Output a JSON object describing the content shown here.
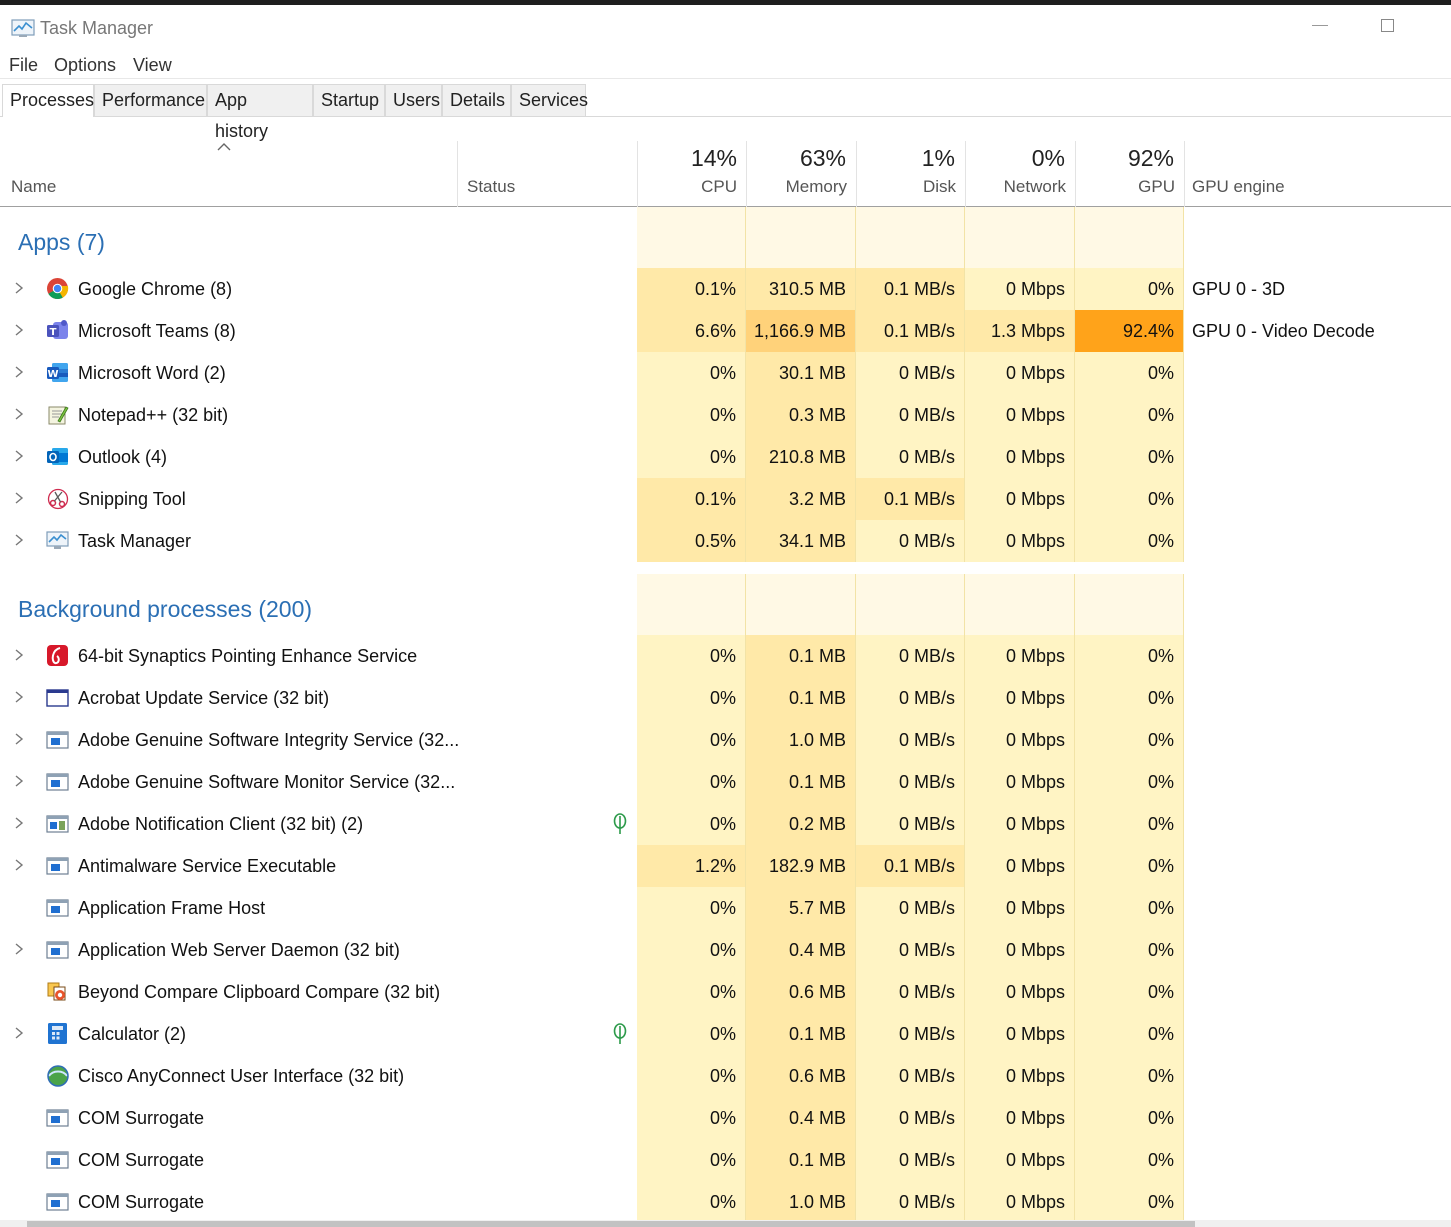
{
  "window": {
    "title": "Task Manager"
  },
  "menu": [
    "File",
    "Options",
    "View"
  ],
  "tabs": [
    "Processes",
    "Performance",
    "App history",
    "Startup",
    "Users",
    "Details",
    "Services"
  ],
  "active_tab": "Processes",
  "columns": {
    "name": "Name",
    "status": "Status",
    "cpu": {
      "label": "CPU",
      "pct": "14%"
    },
    "memory": {
      "label": "Memory",
      "pct": "63%"
    },
    "disk": {
      "label": "Disk",
      "pct": "1%"
    },
    "network": {
      "label": "Network",
      "pct": "0%"
    },
    "gpu": {
      "label": "GPU",
      "pct": "92%"
    },
    "gpu_engine": "GPU engine"
  },
  "heat_colors": {
    "light": "#fff4c4",
    "medium": "#ffe9a8",
    "strong": "#ffd27a",
    "hot": "#ffa31a",
    "group": "#fff9e5"
  },
  "groups": [
    {
      "title": "Apps (7)",
      "rows": [
        {
          "icon": "chrome-icon",
          "name": "Google Chrome (8)",
          "expand": true,
          "status_icon": "",
          "cpu": "0.1%",
          "memory": "310.5 MB",
          "disk": "0.1 MB/s",
          "network": "0 Mbps",
          "gpu": "0%",
          "gpu_engine": "GPU 0 - 3D",
          "heat": {
            "cpu": "medium",
            "memory": "medium",
            "disk": "medium",
            "network": "light",
            "gpu": "light"
          }
        },
        {
          "icon": "teams-icon",
          "name": "Microsoft Teams (8)",
          "expand": true,
          "status_icon": "",
          "cpu": "6.6%",
          "memory": "1,166.9 MB",
          "disk": "0.1 MB/s",
          "network": "1.3 Mbps",
          "gpu": "92.4%",
          "gpu_engine": "GPU 0 - Video Decode",
          "heat": {
            "cpu": "medium",
            "memory": "strong",
            "disk": "medium",
            "network": "medium",
            "gpu": "hot"
          }
        },
        {
          "icon": "word-icon",
          "name": "Microsoft Word (2)",
          "expand": true,
          "status_icon": "",
          "cpu": "0%",
          "memory": "30.1 MB",
          "disk": "0 MB/s",
          "network": "0 Mbps",
          "gpu": "0%",
          "gpu_engine": "",
          "heat": {
            "cpu": "light",
            "memory": "medium",
            "disk": "light",
            "network": "light",
            "gpu": "light"
          }
        },
        {
          "icon": "notepadpp-icon",
          "name": "Notepad++ (32 bit)",
          "expand": true,
          "status_icon": "",
          "cpu": "0%",
          "memory": "0.3 MB",
          "disk": "0 MB/s",
          "network": "0 Mbps",
          "gpu": "0%",
          "gpu_engine": "",
          "heat": {
            "cpu": "light",
            "memory": "medium",
            "disk": "light",
            "network": "light",
            "gpu": "light"
          }
        },
        {
          "icon": "outlook-icon",
          "name": "Outlook (4)",
          "expand": true,
          "status_icon": "",
          "cpu": "0%",
          "memory": "210.8 MB",
          "disk": "0 MB/s",
          "network": "0 Mbps",
          "gpu": "0%",
          "gpu_engine": "",
          "heat": {
            "cpu": "light",
            "memory": "medium",
            "disk": "light",
            "network": "light",
            "gpu": "light"
          }
        },
        {
          "icon": "snipping-tool-icon",
          "name": "Snipping Tool",
          "expand": true,
          "status_icon": "",
          "cpu": "0.1%",
          "memory": "3.2 MB",
          "disk": "0.1 MB/s",
          "network": "0 Mbps",
          "gpu": "0%",
          "gpu_engine": "",
          "heat": {
            "cpu": "medium",
            "memory": "medium",
            "disk": "medium",
            "network": "light",
            "gpu": "light"
          }
        },
        {
          "icon": "task-manager-icon",
          "name": "Task Manager",
          "expand": true,
          "status_icon": "",
          "cpu": "0.5%",
          "memory": "34.1 MB",
          "disk": "0 MB/s",
          "network": "0 Mbps",
          "gpu": "0%",
          "gpu_engine": "",
          "heat": {
            "cpu": "medium",
            "memory": "medium",
            "disk": "light",
            "network": "light",
            "gpu": "light"
          }
        }
      ]
    },
    {
      "title": "Background processes (200)",
      "rows": [
        {
          "icon": "synaptics-icon",
          "name": "64-bit Synaptics Pointing Enhance Service",
          "expand": true,
          "status_icon": "",
          "cpu": "0%",
          "memory": "0.1 MB",
          "disk": "0 MB/s",
          "network": "0 Mbps",
          "gpu": "0%",
          "gpu_engine": "",
          "heat": {
            "cpu": "light",
            "memory": "medium",
            "disk": "light",
            "network": "light",
            "gpu": "light"
          }
        },
        {
          "icon": "window-icon",
          "name": "Acrobat Update Service (32 bit)",
          "expand": true,
          "status_icon": "",
          "cpu": "0%",
          "memory": "0.1 MB",
          "disk": "0 MB/s",
          "network": "0 Mbps",
          "gpu": "0%",
          "gpu_engine": "",
          "heat": {
            "cpu": "light",
            "memory": "medium",
            "disk": "light",
            "network": "light",
            "gpu": "light"
          }
        },
        {
          "icon": "service-icon",
          "name": "Adobe Genuine Software Integrity Service (32...",
          "expand": true,
          "status_icon": "",
          "cpu": "0%",
          "memory": "1.0 MB",
          "disk": "0 MB/s",
          "network": "0 Mbps",
          "gpu": "0%",
          "gpu_engine": "",
          "heat": {
            "cpu": "light",
            "memory": "medium",
            "disk": "light",
            "network": "light",
            "gpu": "light"
          }
        },
        {
          "icon": "service-icon",
          "name": "Adobe Genuine Software Monitor Service (32...",
          "expand": true,
          "status_icon": "",
          "cpu": "0%",
          "memory": "0.1 MB",
          "disk": "0 MB/s",
          "network": "0 Mbps",
          "gpu": "0%",
          "gpu_engine": "",
          "heat": {
            "cpu": "light",
            "memory": "medium",
            "disk": "light",
            "network": "light",
            "gpu": "light"
          }
        },
        {
          "icon": "notification-client-icon",
          "name": "Adobe Notification Client (32 bit) (2)",
          "expand": true,
          "status_icon": "leaf-icon",
          "cpu": "0%",
          "memory": "0.2 MB",
          "disk": "0 MB/s",
          "network": "0 Mbps",
          "gpu": "0%",
          "gpu_engine": "",
          "heat": {
            "cpu": "light",
            "memory": "medium",
            "disk": "light",
            "network": "light",
            "gpu": "light"
          }
        },
        {
          "icon": "service-icon",
          "name": "Antimalware Service Executable",
          "expand": true,
          "status_icon": "",
          "cpu": "1.2%",
          "memory": "182.9 MB",
          "disk": "0.1 MB/s",
          "network": "0 Mbps",
          "gpu": "0%",
          "gpu_engine": "",
          "heat": {
            "cpu": "medium",
            "memory": "medium",
            "disk": "medium",
            "network": "light",
            "gpu": "light"
          }
        },
        {
          "icon": "service-icon",
          "name": "Application Frame Host",
          "expand": false,
          "status_icon": "",
          "cpu": "0%",
          "memory": "5.7 MB",
          "disk": "0 MB/s",
          "network": "0 Mbps",
          "gpu": "0%",
          "gpu_engine": "",
          "heat": {
            "cpu": "light",
            "memory": "medium",
            "disk": "light",
            "network": "light",
            "gpu": "light"
          }
        },
        {
          "icon": "service-icon",
          "name": "Application Web Server Daemon (32 bit)",
          "expand": true,
          "status_icon": "",
          "cpu": "0%",
          "memory": "0.4 MB",
          "disk": "0 MB/s",
          "network": "0 Mbps",
          "gpu": "0%",
          "gpu_engine": "",
          "heat": {
            "cpu": "light",
            "memory": "medium",
            "disk": "light",
            "network": "light",
            "gpu": "light"
          }
        },
        {
          "icon": "beyond-compare-icon",
          "name": "Beyond Compare Clipboard Compare (32 bit)",
          "expand": false,
          "status_icon": "",
          "cpu": "0%",
          "memory": "0.6 MB",
          "disk": "0 MB/s",
          "network": "0 Mbps",
          "gpu": "0%",
          "gpu_engine": "",
          "heat": {
            "cpu": "light",
            "memory": "medium",
            "disk": "light",
            "network": "light",
            "gpu": "light"
          }
        },
        {
          "icon": "calculator-icon",
          "name": "Calculator (2)",
          "expand": true,
          "status_icon": "leaf-icon",
          "cpu": "0%",
          "memory": "0.1 MB",
          "disk": "0 MB/s",
          "network": "0 Mbps",
          "gpu": "0%",
          "gpu_engine": "",
          "heat": {
            "cpu": "light",
            "memory": "medium",
            "disk": "light",
            "network": "light",
            "gpu": "light"
          }
        },
        {
          "icon": "cisco-anyconnect-icon",
          "name": "Cisco AnyConnect User Interface (32 bit)",
          "expand": false,
          "status_icon": "",
          "cpu": "0%",
          "memory": "0.6 MB",
          "disk": "0 MB/s",
          "network": "0 Mbps",
          "gpu": "0%",
          "gpu_engine": "",
          "heat": {
            "cpu": "light",
            "memory": "medium",
            "disk": "light",
            "network": "light",
            "gpu": "light"
          }
        },
        {
          "icon": "service-icon",
          "name": "COM Surrogate",
          "expand": false,
          "status_icon": "",
          "cpu": "0%",
          "memory": "0.4 MB",
          "disk": "0 MB/s",
          "network": "0 Mbps",
          "gpu": "0%",
          "gpu_engine": "",
          "heat": {
            "cpu": "light",
            "memory": "medium",
            "disk": "light",
            "network": "light",
            "gpu": "light"
          }
        },
        {
          "icon": "service-icon",
          "name": "COM Surrogate",
          "expand": false,
          "status_icon": "",
          "cpu": "0%",
          "memory": "0.1 MB",
          "disk": "0 MB/s",
          "network": "0 Mbps",
          "gpu": "0%",
          "gpu_engine": "",
          "heat": {
            "cpu": "light",
            "memory": "medium",
            "disk": "light",
            "network": "light",
            "gpu": "light"
          }
        },
        {
          "icon": "service-icon",
          "name": "COM Surrogate",
          "expand": false,
          "status_icon": "",
          "cpu": "0%",
          "memory": "1.0 MB",
          "disk": "0 MB/s",
          "network": "0 Mbps",
          "gpu": "0%",
          "gpu_engine": "",
          "heat": {
            "cpu": "light",
            "memory": "medium",
            "disk": "light",
            "network": "light",
            "gpu": "light"
          }
        }
      ]
    }
  ]
}
